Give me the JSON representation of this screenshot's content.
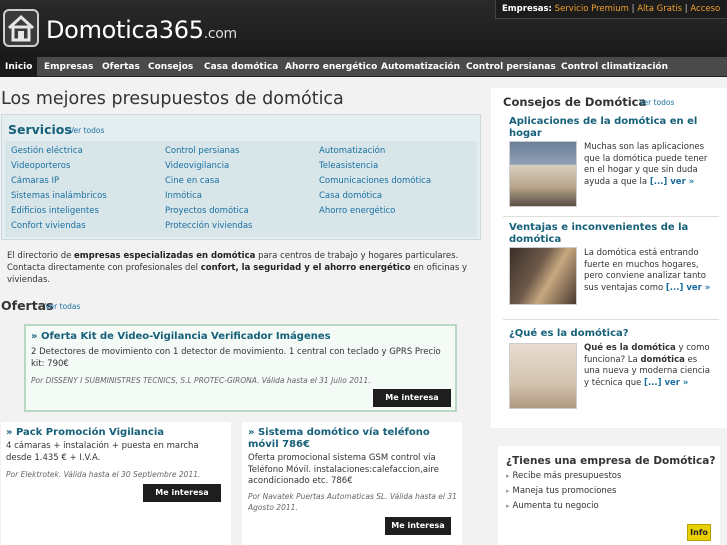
{
  "header": {
    "logo_text": "Domotica365",
    "logo_suffix": ".com",
    "empresas_label": "Empresas:",
    "links": [
      "Servicio Premium",
      "Alta Gratis",
      "Acceso"
    ]
  },
  "nav": [
    "Inicio",
    "Empresas",
    "Ofertas",
    "Consejos",
    "Casa domótica",
    "Ahorro energético",
    "Automatización",
    "Control persianas",
    "Control climatización"
  ],
  "headline": "Los mejores presupuestos de domótica",
  "servicios": {
    "title": "Servicios",
    "ver_todos": "Ver todos",
    "columns": [
      [
        "Gestión eléctrica",
        "Videoporteros",
        "Cámaras IP",
        "Sistemas inalámbricos",
        "Edificios inteligentes",
        "Confort viviendas"
      ],
      [
        "Control persianas",
        "Videovigilancia",
        "Cine en casa",
        "Inmótica",
        "Proyectos domótica",
        "Protección viviendas"
      ],
      [
        "Automatización",
        "Teleasistencia",
        "Comunicaciones domótica",
        "Casa domótica",
        "Ahorro energético"
      ]
    ]
  },
  "intro": {
    "p1": "El directorio de ",
    "b1": "empresas especializadas en domótica",
    "p2": " para centros de trabajo y hogares particulares. Contacta directamente con profesionales del ",
    "b2": "confort, la seguridad y el ahorro energético",
    "p3": " en oficinas y viviendas."
  },
  "ofertas": {
    "title": "Ofertas",
    "ver_todas": "Ver todas",
    "button_label": "Me interesa",
    "items": [
      {
        "title": "» Oferta Kit de Video-Vigilancia Verificador Imágenes",
        "desc": "2 Detectores de movimiento con 1 detector de movimiento. 1 central con teclado y GPRS Precio kit: 790€",
        "meta": "Por DISSENY I SUBMINISTRES TECNICS, S.L PROTEC-GIRONA. Válida hasta el 31 Julio 2011."
      },
      {
        "title": "» Pack Promoción Vigilancia",
        "desc": "4 cámaras + instalación + puesta en marcha desde 1.435 € + I.V.A.",
        "meta": "Por Elektrotek. Válida hasta el 30 Septiembre 2011."
      },
      {
        "title": "» Sistema domótico vía teléfono móvil 786€",
        "desc": "Oferta promocional sistema GSM control vía Teléfono Móvil. instalaciones:calefaccion,aire acondicionado etc. 786€",
        "meta": "Por Navatek Puertas Automaticas SL. Válida hasta el 31 Agosto 2011."
      }
    ]
  },
  "consejos": {
    "title": "Consejos de Domótica",
    "ver_todos": "Ver todos",
    "more": "[...] ver »",
    "articles": [
      {
        "title": "Aplicaciones de la domótica en el hogar",
        "text": "Muchas son las aplicaciones que la domótica puede tener en el hogar y que sin duda ayuda a que la"
      },
      {
        "title": "Ventajas e inconvenientes de la domótica",
        "text": "La domótica está entrando fuerte en muchos hogares, pero conviene analizar tanto sus ventajas como"
      },
      {
        "title": "¿Qué es la domótica?",
        "bold1": "Qué es la domótica",
        "mid": " y como funciona? La ",
        "bold2": "domótica",
        "end": " es una nueva y moderna ciencia y técnica que"
      }
    ]
  },
  "empresa_box": {
    "title": "¿Tienes una empresa de Domótica?",
    "items": [
      "Recibe más presupuestos",
      "Maneja tus promociones",
      "Aumenta tu negocio"
    ],
    "info_label": "Info"
  },
  "colors": {
    "header_bg": "#1a1a1a",
    "nav_bg": "#4a4a4a",
    "link_blue": "#16607a",
    "accent_orange": "#f0a030",
    "info_yellow": "#e8d000"
  }
}
